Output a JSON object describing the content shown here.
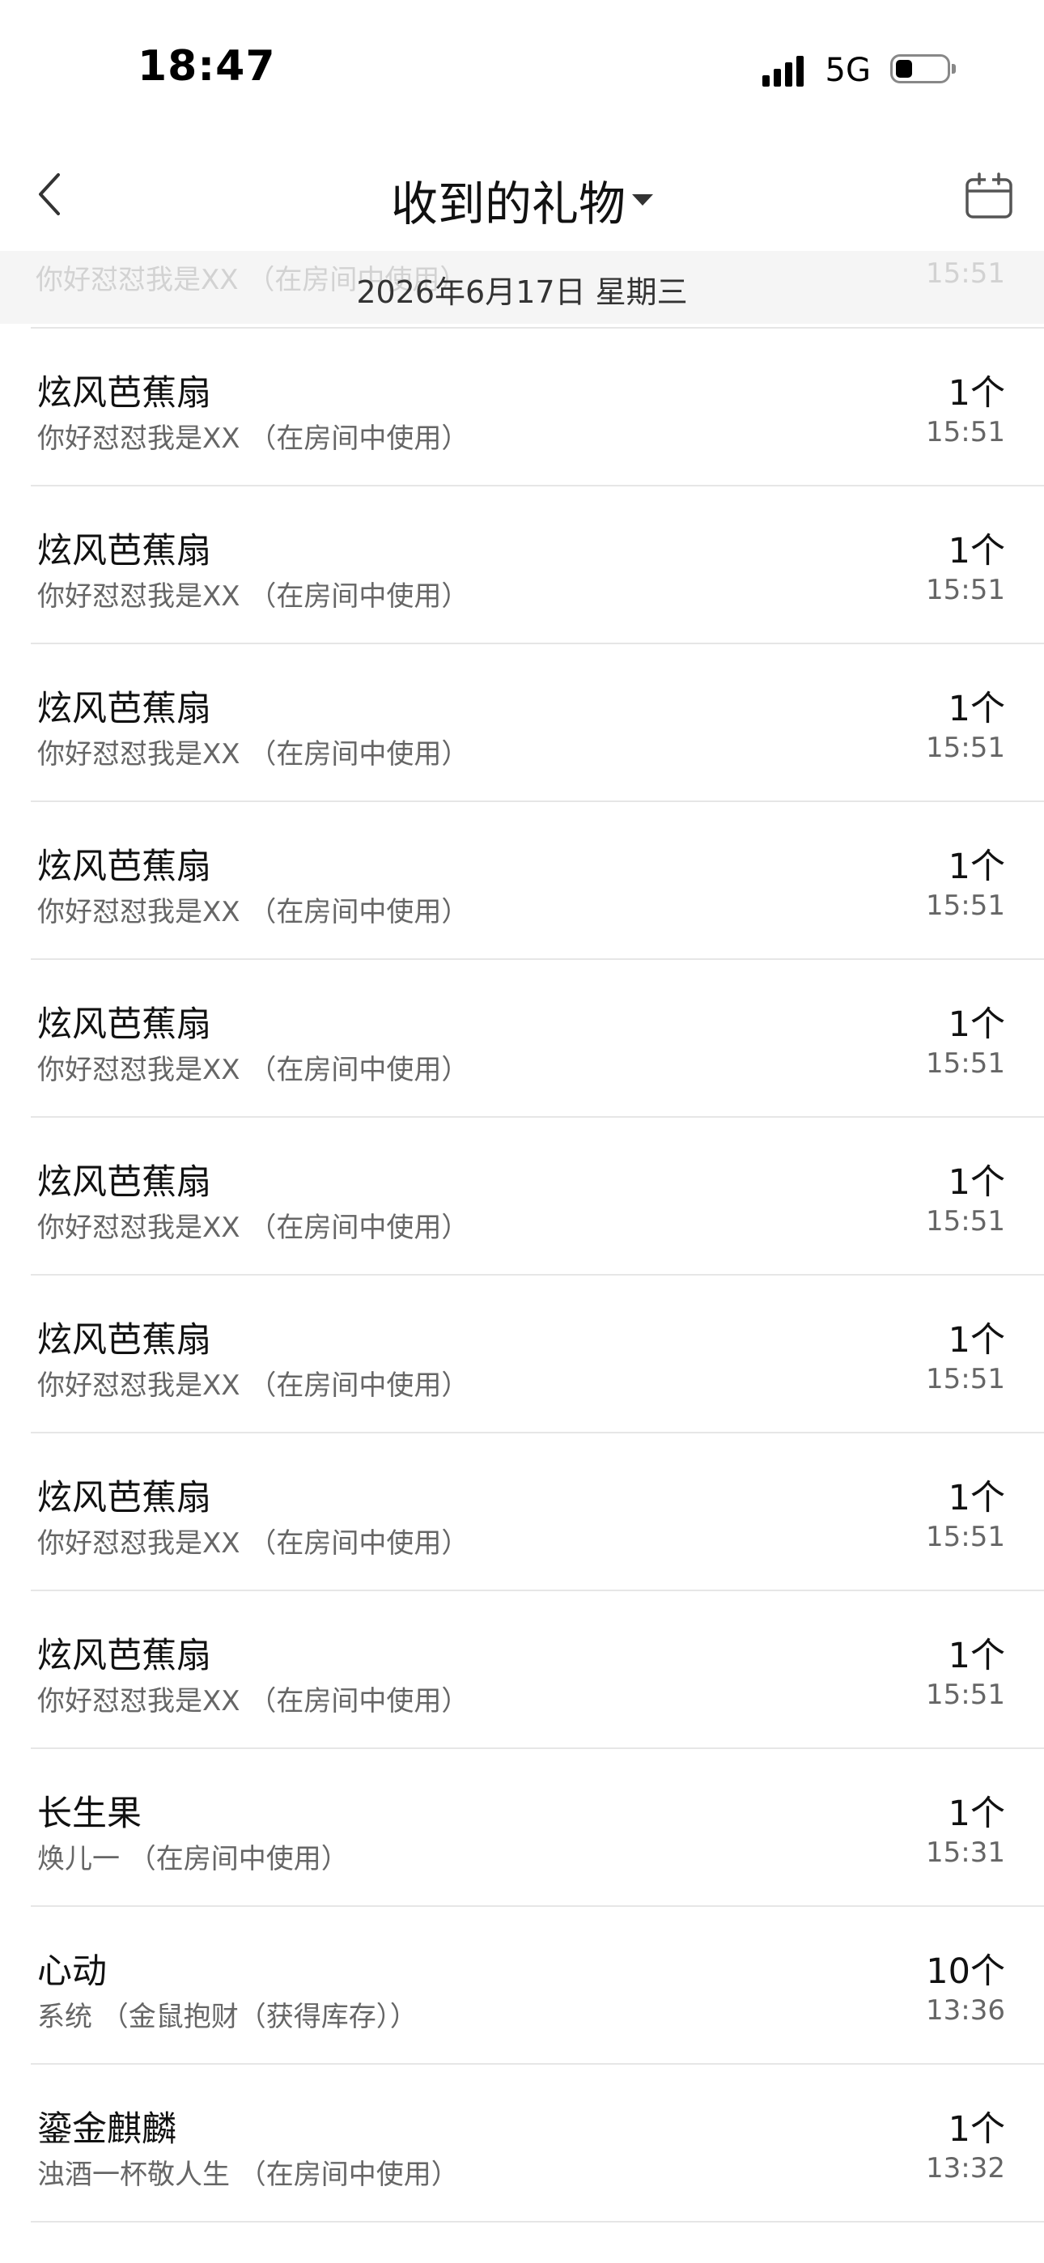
{
  "status_bar": {
    "time": "18:47",
    "network": "5G"
  },
  "nav": {
    "title": "收到的礼物"
  },
  "date_band": {
    "date": "2026年6月17日 星期三",
    "ghost_sender": "你好怼怼我是XX （在房间中使用）",
    "ghost_time": "15:51"
  },
  "gifts": [
    {
      "name": "炫风芭蕉扇",
      "sender": "你好怼怼我是XX （在房间中使用）",
      "count": "1个",
      "time": "15:51"
    },
    {
      "name": "炫风芭蕉扇",
      "sender": "你好怼怼我是XX （在房间中使用）",
      "count": "1个",
      "time": "15:51"
    },
    {
      "name": "炫风芭蕉扇",
      "sender": "你好怼怼我是XX （在房间中使用）",
      "count": "1个",
      "time": "15:51"
    },
    {
      "name": "炫风芭蕉扇",
      "sender": "你好怼怼我是XX （在房间中使用）",
      "count": "1个",
      "time": "15:51"
    },
    {
      "name": "炫风芭蕉扇",
      "sender": "你好怼怼我是XX （在房间中使用）",
      "count": "1个",
      "time": "15:51"
    },
    {
      "name": "炫风芭蕉扇",
      "sender": "你好怼怼我是XX （在房间中使用）",
      "count": "1个",
      "time": "15:51"
    },
    {
      "name": "炫风芭蕉扇",
      "sender": "你好怼怼我是XX （在房间中使用）",
      "count": "1个",
      "time": "15:51"
    },
    {
      "name": "炫风芭蕉扇",
      "sender": "你好怼怼我是XX （在房间中使用）",
      "count": "1个",
      "time": "15:51"
    },
    {
      "name": "炫风芭蕉扇",
      "sender": "你好怼怼我是XX （在房间中使用）",
      "count": "1个",
      "time": "15:51"
    },
    {
      "name": "长生果",
      "sender": "焕儿一 （在房间中使用）",
      "count": "1个",
      "time": "15:31"
    },
    {
      "name": "心动",
      "sender": "系统 （金鼠抱财（获得库存））",
      "count": "10个",
      "time": "13:36"
    },
    {
      "name": "鎏金麒麟",
      "sender": "浊酒一杯敬人生 （在房间中使用）",
      "count": "1个",
      "time": "13:32"
    }
  ],
  "icons": {
    "back": "chevron-left-icon",
    "dropdown": "caret-down-icon",
    "calendar": "calendar-icon",
    "signal": "cellular-signal-icon",
    "battery": "battery-icon"
  }
}
